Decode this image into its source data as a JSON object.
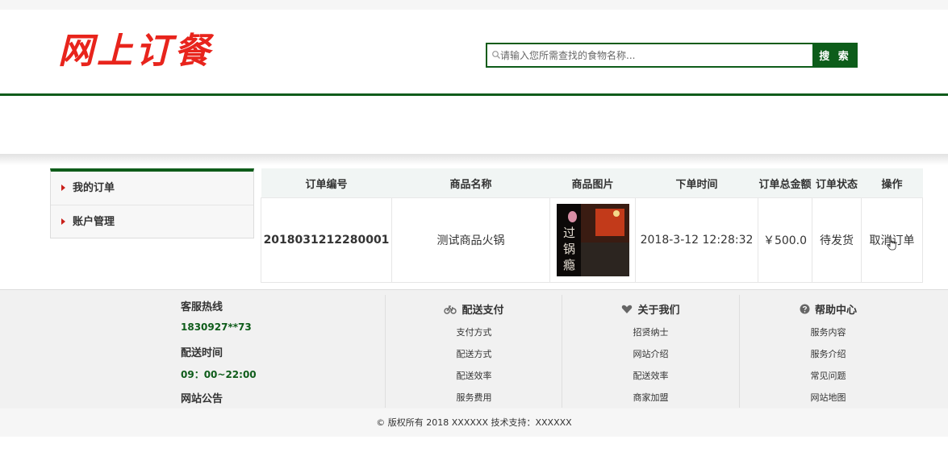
{
  "header": {
    "logo_text": "网上订餐",
    "search": {
      "placeholder": "请输入您所需查找的食物名称...",
      "button_label": "搜 索"
    }
  },
  "sidebar": {
    "items": [
      {
        "label": "我的订单"
      },
      {
        "label": "账户管理"
      }
    ]
  },
  "orders": {
    "columns": [
      "订单编号",
      "商品名称",
      "商品图片",
      "下单时间",
      "订单总金额",
      "订单状态",
      "操作"
    ],
    "rows": [
      {
        "order_id": "2018031212280001",
        "product_name": "测试商品火锅",
        "image_text": [
          "过",
          "锅",
          "瘾"
        ],
        "order_time": "2018-3-12 12:28:32",
        "total": "￥500.0",
        "status": "待发货",
        "action": "取消订单"
      }
    ]
  },
  "footer": {
    "contact": {
      "hotline_label": "客服热线",
      "hotline": "1830927**73",
      "delivery_time_label": "配送时间",
      "delivery_time": "09：00~22:00",
      "notice_label": "网站公告"
    },
    "columns": [
      {
        "title": "配送支付",
        "icon": "bicycle-icon",
        "links": [
          "支付方式",
          "配送方式",
          "配送效率",
          "服务费用"
        ]
      },
      {
        "title": "关于我们",
        "icon": "heart-icon",
        "links": [
          "招贤纳士",
          "网站介绍",
          "配送效率",
          "商家加盟"
        ]
      },
      {
        "title": "帮助中心",
        "icon": "help-icon",
        "links": [
          "服务内容",
          "服务介绍",
          "常见问题",
          "网站地图"
        ]
      }
    ],
    "copyright": "© 版权所有 2018 XXXXXX 技术支持：XXXXXX"
  },
  "colors": {
    "brand_green": "#0e5c1a",
    "logo_red": "#e8241c",
    "arrow_red": "#c9201a"
  }
}
